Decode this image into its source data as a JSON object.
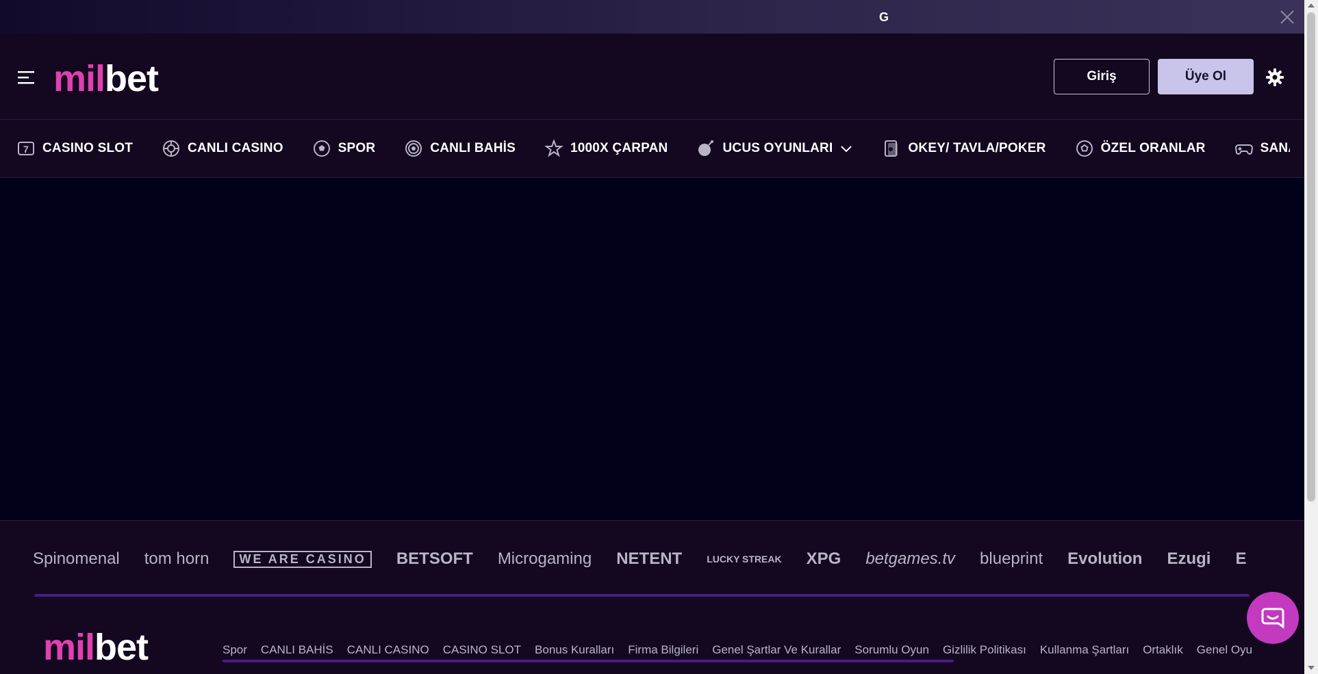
{
  "topbar": {
    "text": "G"
  },
  "header": {
    "logo": {
      "part1": "mil",
      "part2": "bet"
    },
    "login_label": "Giriş",
    "register_label": "Üye Ol"
  },
  "nav": {
    "items": [
      {
        "label": "CASINO SLOT",
        "icon": "slot-7-icon"
      },
      {
        "label": "CANLI CASINO",
        "icon": "roulette-icon"
      },
      {
        "label": "SPOR",
        "icon": "soccer-ball-icon"
      },
      {
        "label": "CANLI BAHİS",
        "icon": "live-broadcast-icon"
      },
      {
        "label": "1000X ÇARPAN",
        "icon": "star-icon"
      },
      {
        "label": "UCUS OYUNLARI",
        "icon": "bomb-icon"
      },
      {
        "label": "OKEY/ TAVLA/POKER",
        "icon": "cards-icon"
      },
      {
        "label": "ÖZEL ORANLAR",
        "icon": "soccer-ball-icon"
      },
      {
        "label": "SANAL BAH",
        "icon": "gamepad-icon"
      }
    ]
  },
  "providers": {
    "items": [
      "Spinomenal",
      "tom horn",
      "WE ARE CASINO",
      "BETSOFT",
      "Microgaming",
      "NETENT",
      "LUCKY STREAK",
      "XPG",
      "betgames.tv",
      "blueprint",
      "Evolution",
      "Ezugi",
      "E"
    ]
  },
  "footer": {
    "logo": {
      "part1": "mil",
      "part2": "bet"
    },
    "links": [
      "Spor",
      "CANLI BAHİS",
      "CANLI CASINO",
      "CASINO SLOT",
      "Bonus Kuralları",
      "Firma Bilgileri",
      "Genel Şartlar Ve Kurallar",
      "Sorumlu Oyun",
      "Gizlilik Politikası",
      "Kullanma Şartları",
      "Ortaklık",
      "Genel Oyu"
    ]
  },
  "colors": {
    "accent": "#e040b0",
    "bg": "#13081f",
    "main_bg": "#01011a",
    "register_bg": "#c9c4ea",
    "chat_bg": "#c339c0"
  }
}
